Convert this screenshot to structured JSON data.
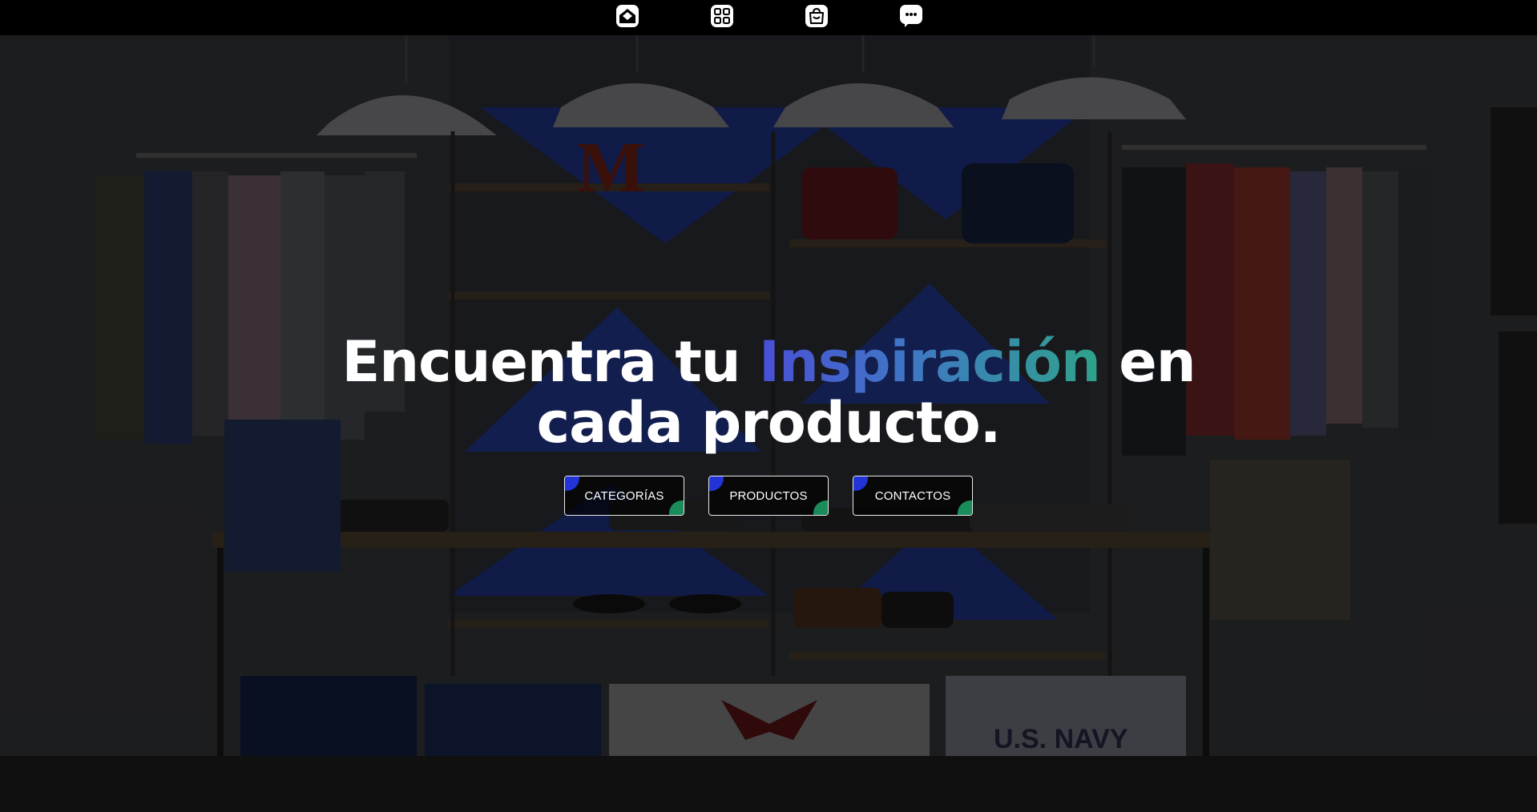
{
  "nav": {
    "icons": [
      {
        "name": "home-icon"
      },
      {
        "name": "categories-grid-icon"
      },
      {
        "name": "shopping-bag-icon"
      },
      {
        "name": "chat-icon"
      }
    ]
  },
  "hero": {
    "headline_part1": "Encuentra tu ",
    "headline_highlight": "Inspiración",
    "headline_part2": " en",
    "headline_line2": "cada producto.",
    "gradient_colors": [
      "#4a4fd6",
      "#3f78c4",
      "#2fa38a"
    ],
    "buttons": [
      {
        "label": "CATEGORÍAS"
      },
      {
        "label": "PRODUCTOS"
      },
      {
        "label": "CONTACTOS"
      }
    ],
    "button_accent_colors": {
      "top_left": "#2233d8",
      "bottom_right": "#1a8c5a"
    }
  }
}
